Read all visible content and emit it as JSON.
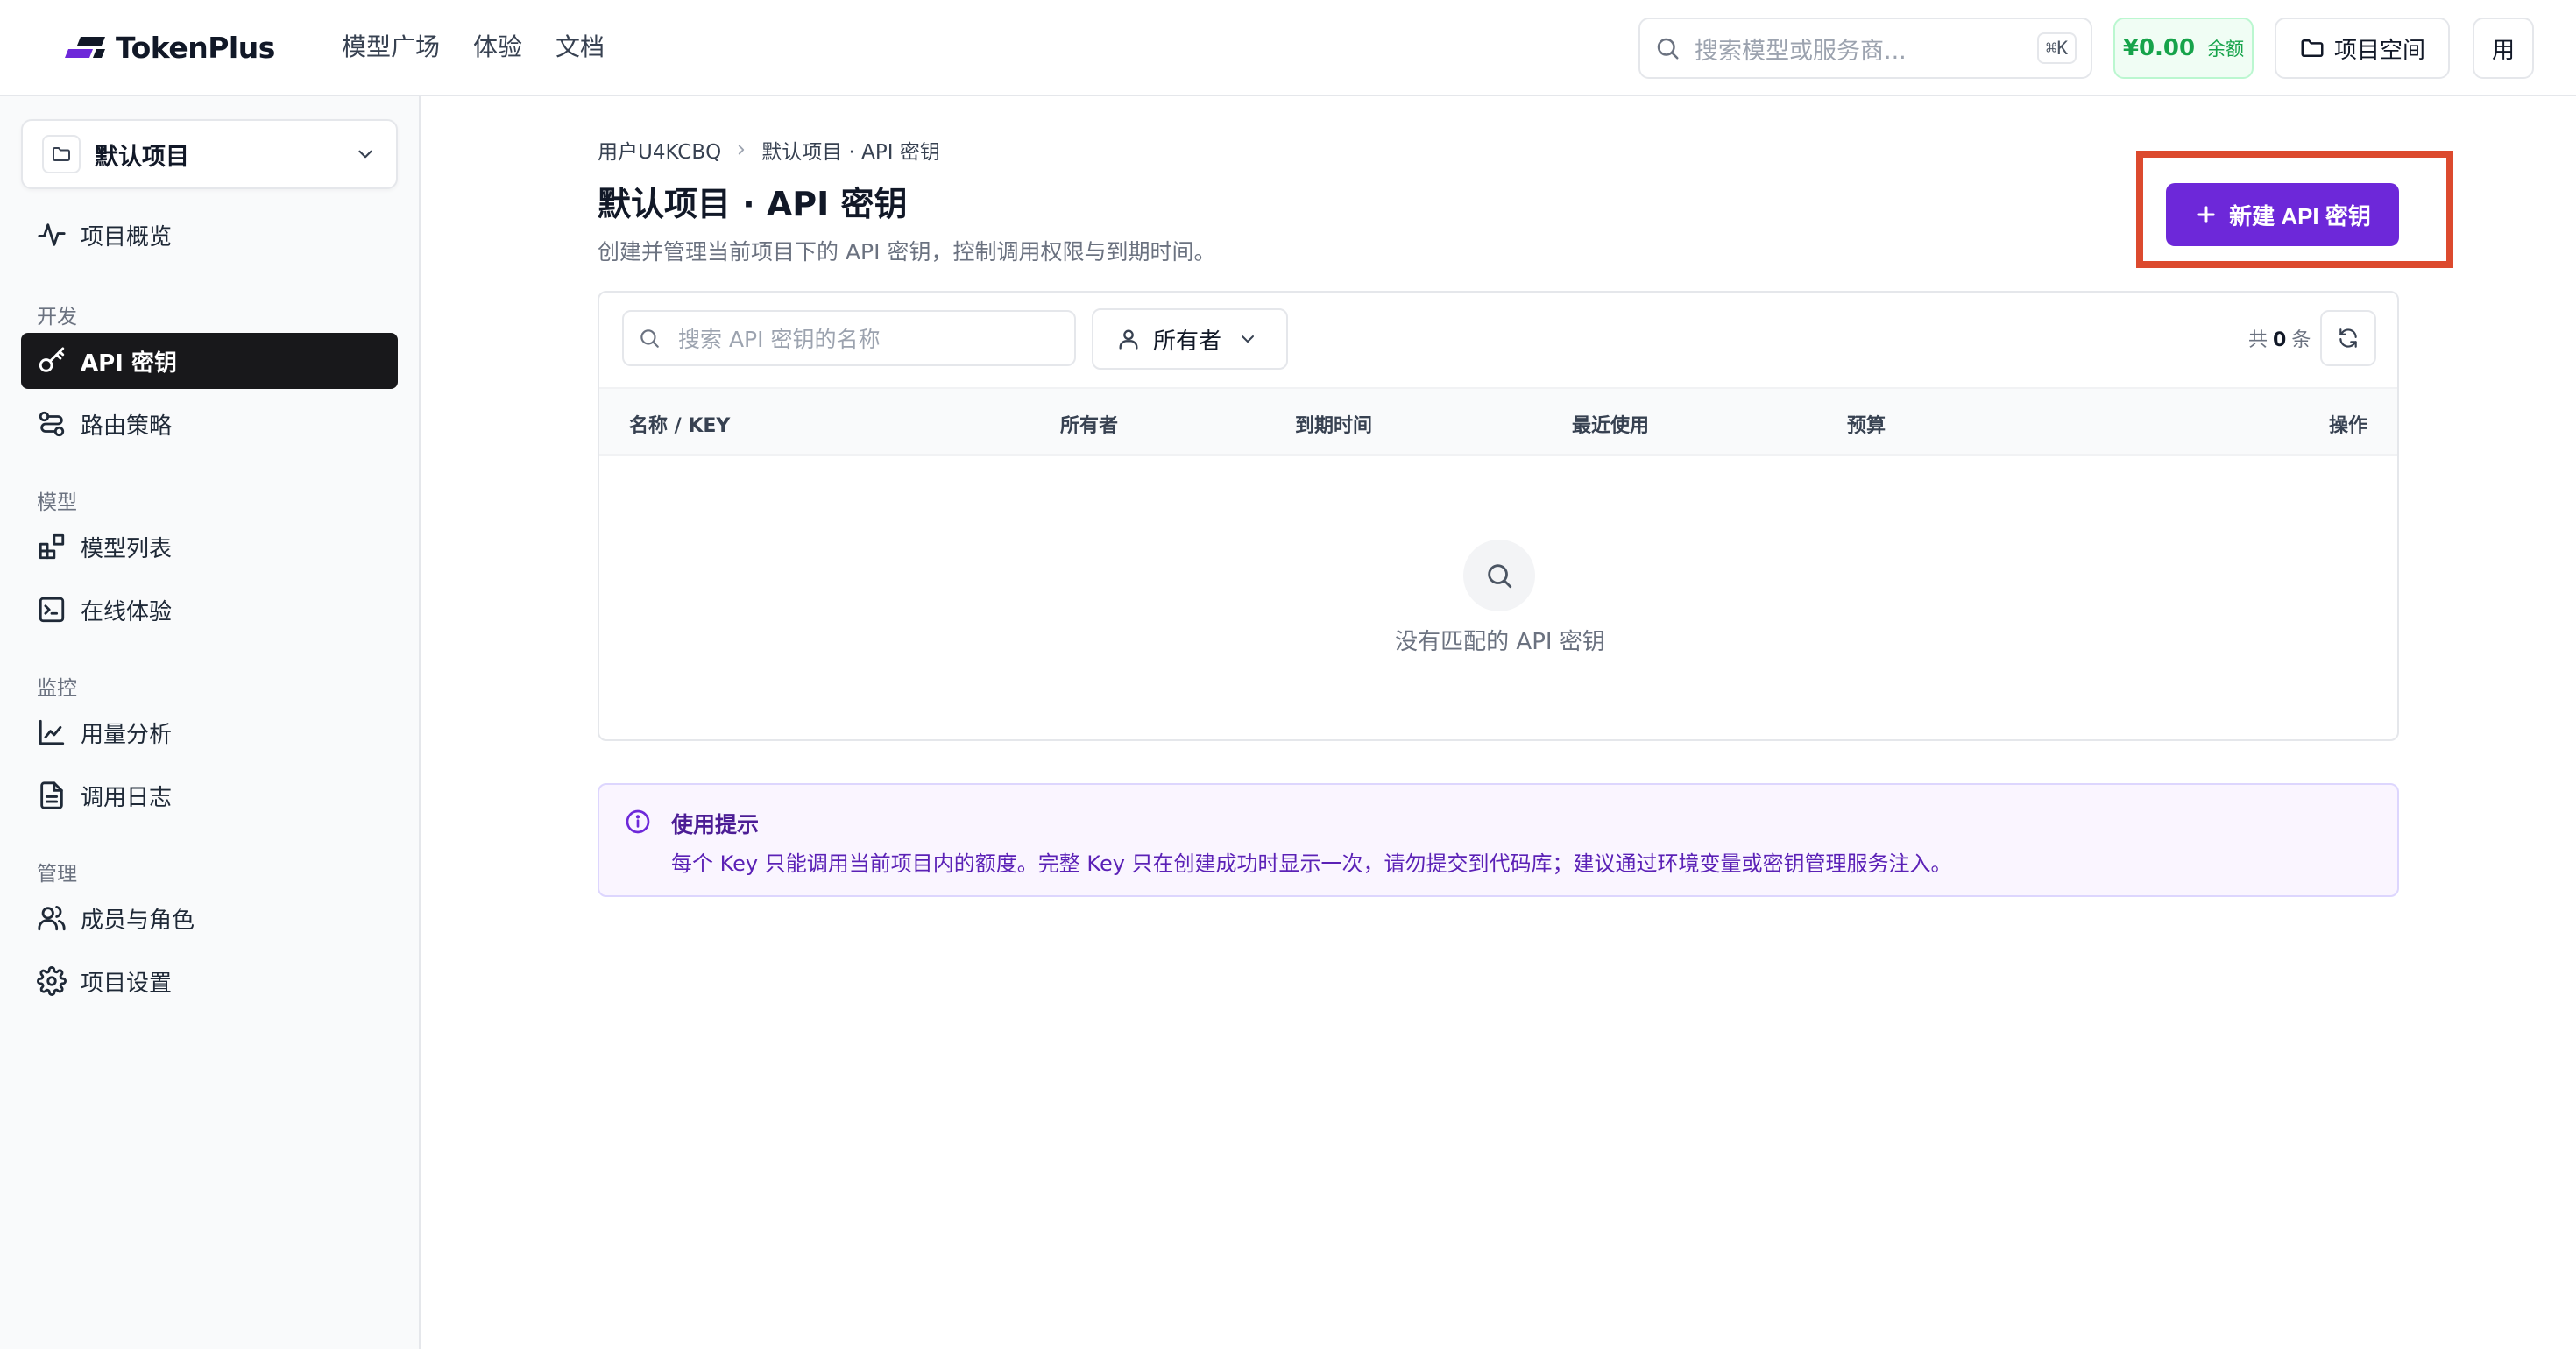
{
  "brand": {
    "name": "TokenPlus",
    "accent": "#6d28d9"
  },
  "topnav": [
    {
      "label": "模型广场"
    },
    {
      "label": "体验"
    },
    {
      "label": "文档"
    }
  ],
  "search": {
    "placeholder": "搜索模型或服务商...",
    "shortcut": "⌘K",
    "icon": "search-icon"
  },
  "balance": {
    "amount": "¥0.00",
    "label": "余额",
    "color": "#16a34a"
  },
  "workspace": {
    "label": "项目空间",
    "icon": "folder-icon"
  },
  "user": {
    "avatar_text": "用"
  },
  "sidebar": {
    "project": {
      "name": "默认项目",
      "icon": "folder-icon"
    },
    "items": [
      {
        "label": "项目概览",
        "icon": "activity-icon"
      },
      {
        "section": "开发"
      },
      {
        "label": "API 密钥",
        "icon": "key-icon",
        "active": true
      },
      {
        "label": "路由策略",
        "icon": "route-icon"
      },
      {
        "section": "模型"
      },
      {
        "label": "模型列表",
        "icon": "blocks-icon"
      },
      {
        "label": "在线体验",
        "icon": "terminal-icon"
      },
      {
        "section": "监控"
      },
      {
        "label": "用量分析",
        "icon": "chart-icon"
      },
      {
        "label": "调用日志",
        "icon": "file-text-icon"
      },
      {
        "section": "管理"
      },
      {
        "label": "成员与角色",
        "icon": "users-icon"
      },
      {
        "label": "项目设置",
        "icon": "gear-icon"
      }
    ]
  },
  "breadcrumb": {
    "user": "用户U4KCBQ",
    "current": "默认项目 · API 密钥"
  },
  "page": {
    "title": "默认项目 · API 密钥",
    "description": "创建并管理当前项目下的 API 密钥，控制调用权限与到期时间。",
    "new_button": "新建 API 密钥"
  },
  "table": {
    "search_placeholder": "搜索 API 密钥的名称",
    "owner_filter": "所有者",
    "count_prefix": "共",
    "count": "0",
    "count_suffix": "条",
    "columns": [
      "名称 / KEY",
      "所有者",
      "到期时间",
      "最近使用",
      "预算",
      "操作"
    ],
    "rows": [],
    "empty_text": "没有匹配的 API 密钥"
  },
  "tip": {
    "title": "使用提示",
    "body": "每个 Key 只能调用当前项目内的额度。完整 Key 只在创建成功时显示一次，请勿提交到代码库；建议通过环境变量或密钥管理服务注入。"
  },
  "highlight": {
    "color": "#dc4a2e"
  }
}
